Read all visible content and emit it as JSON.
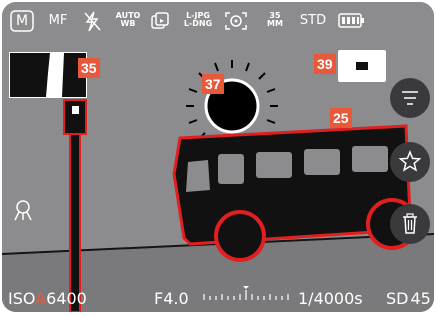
{
  "top_bar": {
    "exposure_mode": "M",
    "focus_mode": "MF",
    "flash_icon": "flash-off-icon",
    "white_balance": [
      "AUTO",
      "WB"
    ],
    "drive_icon": "continuous-shooting-icon",
    "file_format": [
      "L-JPG",
      "L-DNG"
    ],
    "metering_icon": "spot-metering-icon",
    "focal_length": [
      "35",
      "MM"
    ],
    "profile": "STD",
    "battery_icon": "battery-full-icon"
  },
  "callouts": {
    "thumbnail_number": "35",
    "sun_number": "37",
    "mode_number": "39",
    "bus_number": "25"
  },
  "right_buttons": {
    "menu_icon": "menu-icon",
    "favorite_icon": "star-icon",
    "delete_icon": "trash-icon"
  },
  "left_icon": "focus-peaking-icon",
  "bottom_bar": {
    "iso_prefix": "ISO",
    "iso_auto": "A",
    "iso_value": "6400",
    "aperture": "F4.0",
    "shutter": "1/4000s",
    "storage_prefix": "SD",
    "shots_remaining": "45"
  },
  "colors": {
    "accent_red": "#e8593b",
    "highlight_red": "#e02020",
    "background_gray": "#8c8c8e",
    "button_dark": "#3a3a3c"
  }
}
